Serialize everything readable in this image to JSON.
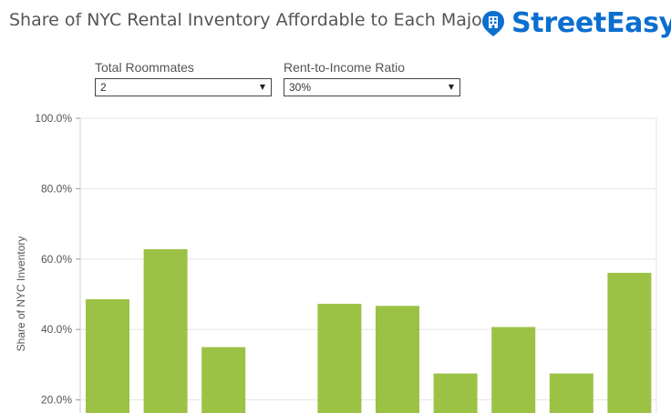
{
  "header": {
    "title": "Share of NYC Rental Inventory Affordable to Each Major",
    "brand_name": "StreetEasy",
    "brand_icon": "building-pin-icon"
  },
  "filters": {
    "roommates": {
      "label": "Total Roommates",
      "value": "2"
    },
    "ratio": {
      "label": "Rent-to-Income Ratio",
      "value": "30%"
    }
  },
  "colors": {
    "bar": "#9bc244",
    "brand": "#0b6fcf",
    "gridline": "#e5e5e5",
    "text": "#555555"
  },
  "chart_data": {
    "type": "bar",
    "ylabel": "Share of NYC Inventory",
    "y_ticks": [
      "100.0%",
      "80.0%",
      "60.0%",
      "40.0%",
      "20.0%"
    ],
    "y_tick_values": [
      100,
      80,
      60,
      40,
      20
    ],
    "ylim": [
      20,
      100
    ],
    "values": [
      48.6,
      62.8,
      35.0,
      null,
      47.3,
      46.7,
      27.5,
      40.7,
      27.5,
      56.1
    ],
    "grid": true
  }
}
